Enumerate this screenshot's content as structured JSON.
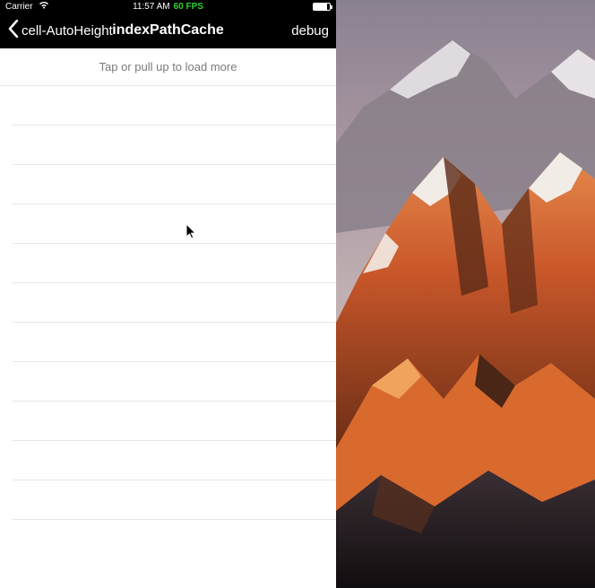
{
  "statusbar": {
    "carrier": "Carrier",
    "time": "11:57 AM",
    "fps": "60 FPS"
  },
  "navbar": {
    "back_label": "cell-AutoHeight",
    "title": "indexPathCache",
    "right": "debug"
  },
  "table": {
    "load_more": "Tap or pull up to load more",
    "row_count": 11
  }
}
